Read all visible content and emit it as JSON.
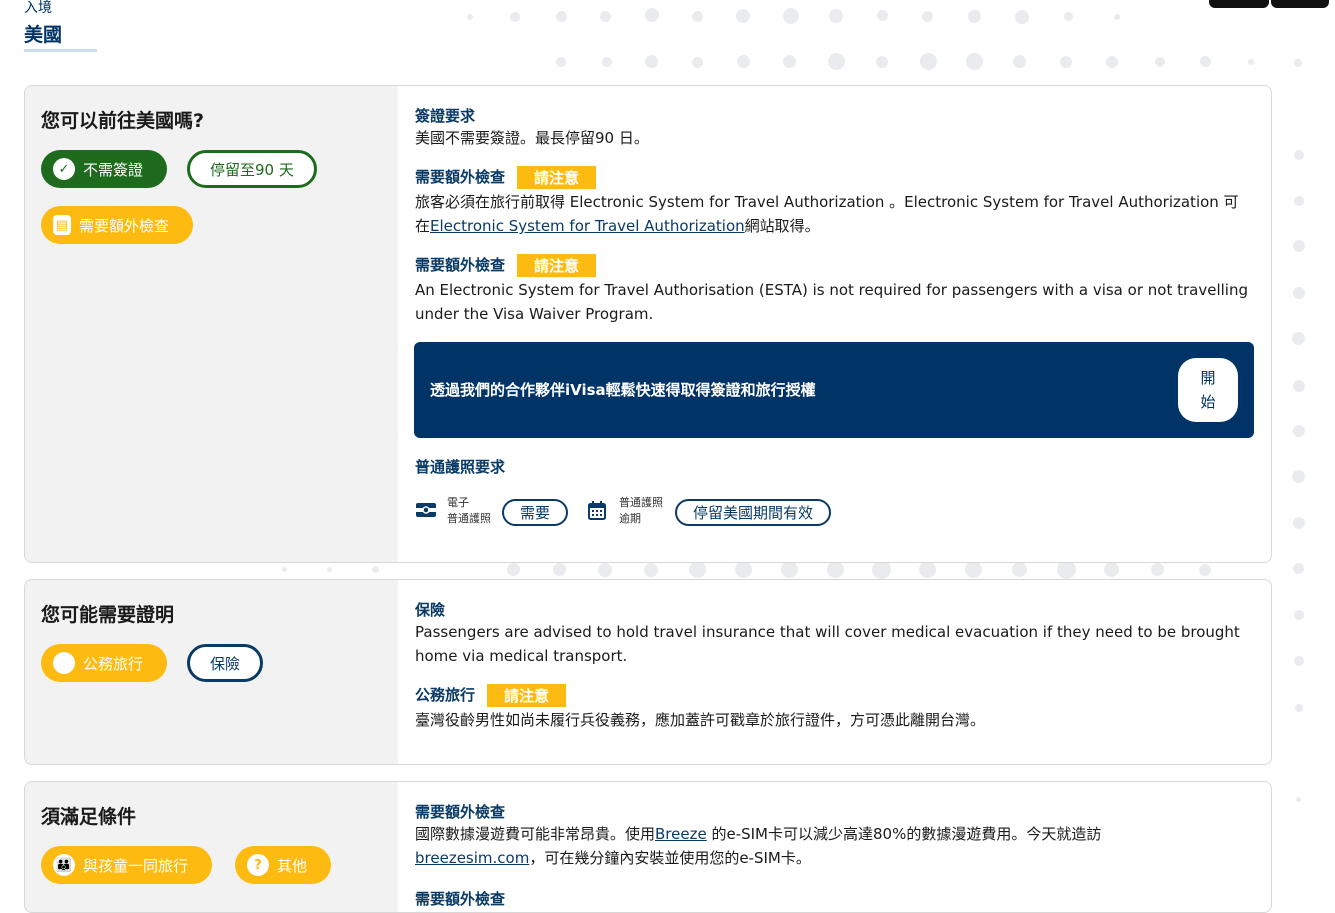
{
  "breadcrumb": "入境",
  "page_title": "美國",
  "card1": {
    "heading": "您可以前往美國嗎?",
    "pills": {
      "no_visa": "不需簽證",
      "stay": "停留至90 天",
      "extra_check": "需要額外檢查"
    },
    "visa_title": "簽證要求",
    "visa_text": "美國不需要簽證。最長停留90 日。",
    "extra1_title": "需要額外檢查",
    "extra1_badge": "請注意",
    "extra1_text_a": "旅客必須在旅行前取得 Electronic System for Travel Authorization 。Electronic System for Travel Authorization 可在",
    "extra1_link": "Electronic System for Travel Authorization",
    "extra1_text_b": "網站取得。",
    "extra2_title": "需要額外檢查",
    "extra2_badge": "請注意",
    "extra2_text": "An Electronic System for Travel Authorisation (ESTA) is not required for passengers with a visa or not travelling under the Visa Waiver Program.",
    "promo_text": "透過我們的合作夥伴iVisa輕鬆快速得取得簽證和旅行授權",
    "promo_button": "開始",
    "passport_title": "普通護照要求",
    "epassport_label_1": "電子",
    "epassport_label_2": "普通護照",
    "epassport_value": "需要",
    "validity_label_1": "普通護照",
    "validity_label_2": "逾期",
    "validity_value": "停留美國期間有效"
  },
  "card2": {
    "heading": "您可能需要證明",
    "pills": {
      "official": "公務旅行",
      "insurance": "保險"
    },
    "insurance_title": "保險",
    "insurance_text": "Passengers are advised to hold travel insurance that will cover medical evacuation if they need to be brought home via medical transport.",
    "official_title": "公務旅行",
    "official_badge": "請注意",
    "official_text": "臺灣役齡男性如尚未履行兵役義務，應加蓋許可戳章於旅行證件，方可憑此離開台灣。"
  },
  "card3": {
    "heading": "須滿足條件",
    "pills": {
      "children": "與孩童一同旅行",
      "other": "其他"
    },
    "extra_title": "需要額外檢查",
    "extra_text_a": "國際數據漫遊費可能非常昂貴。使用",
    "extra_link1": "Breeze",
    "extra_text_b": " 的e-SIM卡可以減少高達80%的數據漫遊費用。今天就造訪",
    "extra_link2": "breezesim.com",
    "extra_text_c": "，可在幾分鐘內安裝並使用您的e-SIM卡。",
    "next_title": "需要額外檢查"
  },
  "colors": {
    "navy": "#003366",
    "green": "#1e6b1e",
    "yellow": "#fdbb12",
    "panel_gray": "#f2f2f2"
  },
  "icons": [
    "check-circle-icon",
    "passport-icon",
    "chip-card-icon",
    "calendar-icon",
    "children-icon",
    "question-icon",
    "circle-icon"
  ]
}
